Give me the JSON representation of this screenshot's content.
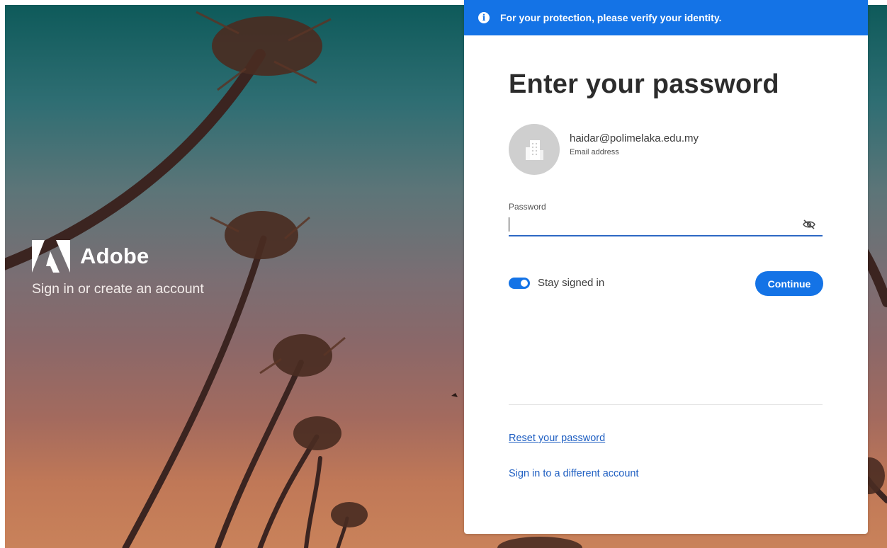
{
  "brand": {
    "name": "Adobe",
    "tagline": "Sign in or create an account"
  },
  "banner": {
    "icon": "info-icon",
    "text": "For your protection, please verify your identity."
  },
  "form": {
    "heading": "Enter your password",
    "account": {
      "avatar_icon": "building-icon",
      "email": "haidar@polimelaka.edu.my",
      "email_label": "Email address"
    },
    "password": {
      "label": "Password",
      "value": "",
      "visibility_icon": "eye-off-icon"
    },
    "stay_signed_in": {
      "label": "Stay signed in",
      "checked": true
    },
    "continue_label": "Continue",
    "reset_link": "Reset your password",
    "switch_account_link": "Sign in to a different account"
  },
  "colors": {
    "accent": "#1473e6",
    "link": "#1f5fc2",
    "heading": "#2c2c2c"
  }
}
